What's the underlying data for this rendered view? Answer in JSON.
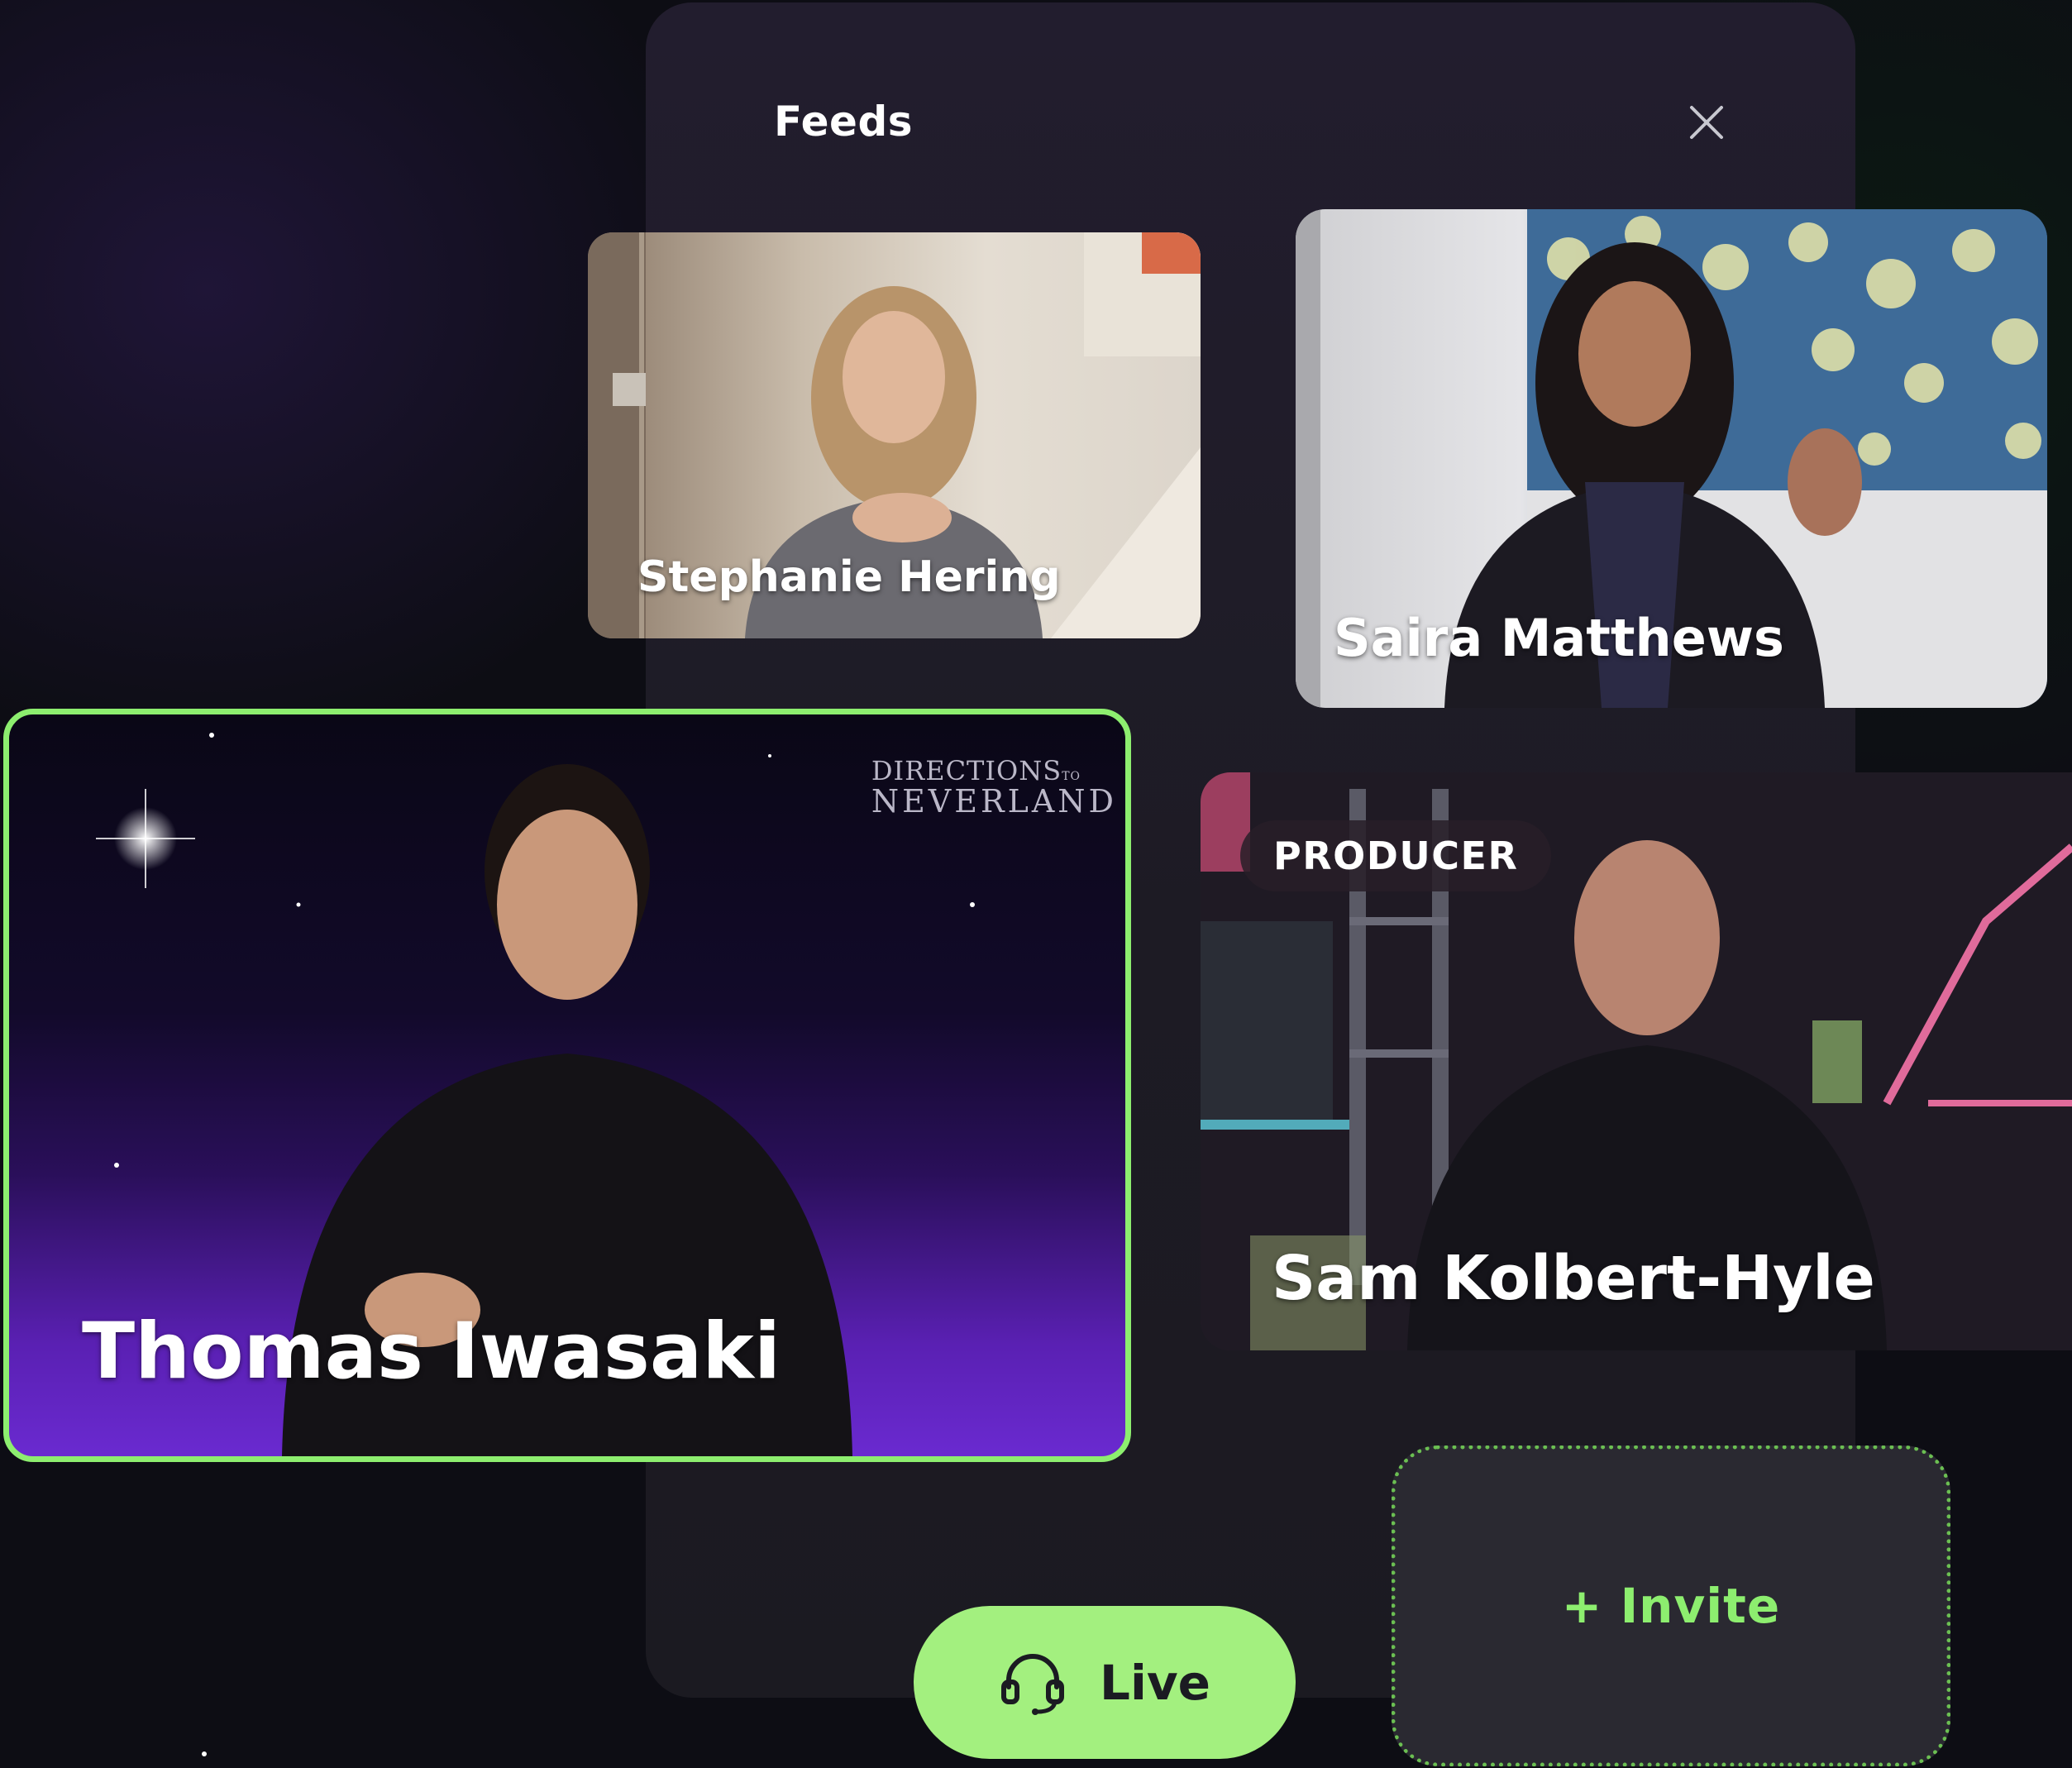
{
  "panel": {
    "title": "Feeds",
    "close_icon": "close-icon"
  },
  "feeds": {
    "stephanie": {
      "name": "Stephanie Hering"
    },
    "saira": {
      "name": "Saira Matthews"
    },
    "thomas": {
      "name": "Thomas Iwasaki",
      "watermark_line1": "DIRECTIONS",
      "watermark_to": "TO",
      "watermark_line2": "NEVERLAND"
    },
    "sam": {
      "name": "Sam Kolbert-Hyle",
      "role": "PRODUCER"
    }
  },
  "actions": {
    "invite_label": "+ Invite",
    "live_label": "Live",
    "live_icon": "headset-icon"
  },
  "colors": {
    "accent_green": "#8dee6f",
    "live_button": "#a3f07f",
    "panel_bg": "#1d1b24"
  }
}
